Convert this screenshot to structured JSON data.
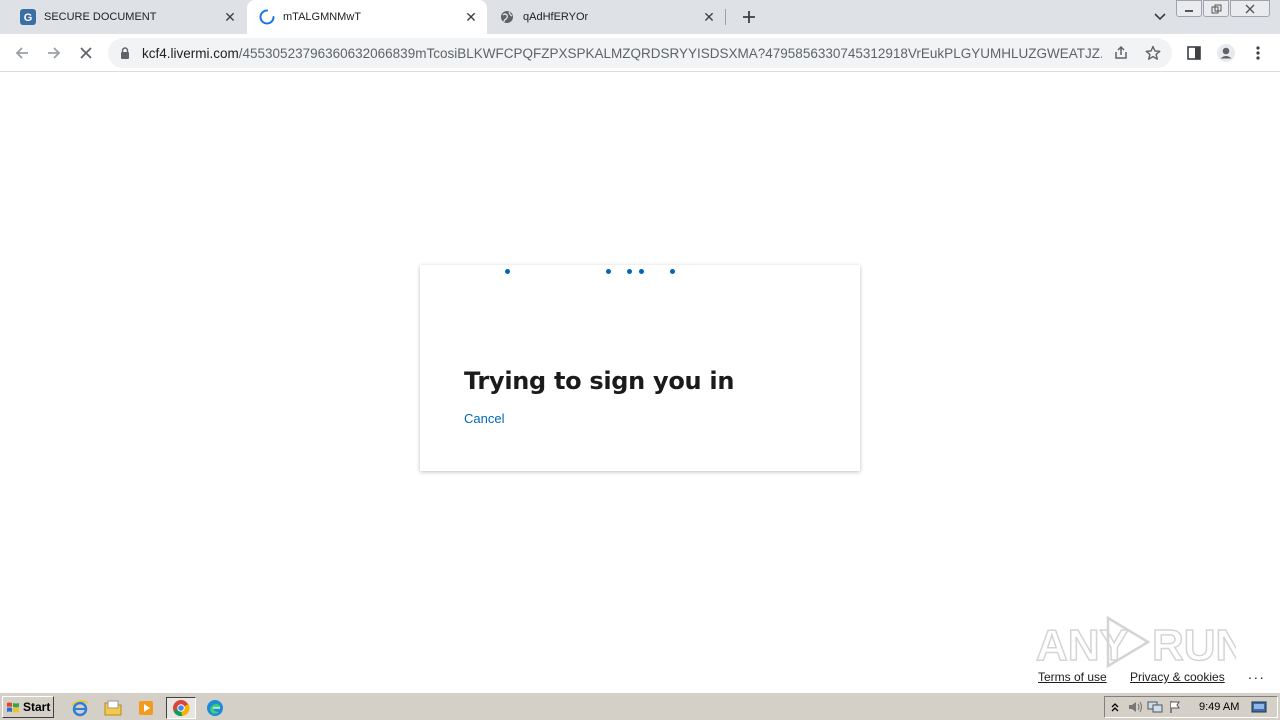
{
  "browser": {
    "tabs": [
      {
        "title": "SECURE DOCUMENT",
        "favicon": "g-letter-icon",
        "active": false
      },
      {
        "title": "mTALGMNMwT",
        "favicon": "loading-spinner-icon",
        "active": true
      },
      {
        "title": "qAdHfERYOr",
        "favicon": "globe-icon",
        "active": false
      }
    ],
    "url_host": "kcf4.livermi.com",
    "url_path": "/455305237963606320668​39mTcosiBLKWFCPQFZPXSPKALMZQRDSRYYISDSXMA?479585633074531291​8VrEukPLGYUMHLUZGWEATJZ..."
  },
  "signin": {
    "heading": "Trying to sign you in",
    "cancel_label": "Cancel"
  },
  "footer": {
    "terms": "Terms of use",
    "privacy": "Privacy & cookies",
    "more": "..."
  },
  "watermark": {
    "text": "ANY RUN"
  },
  "taskbar": {
    "start_label": "Start",
    "clock": "9:49 AM"
  },
  "colors": {
    "accent": "#0067b8",
    "tabstrip": "#dee1e6",
    "taskbar": "#d4d0c8"
  }
}
